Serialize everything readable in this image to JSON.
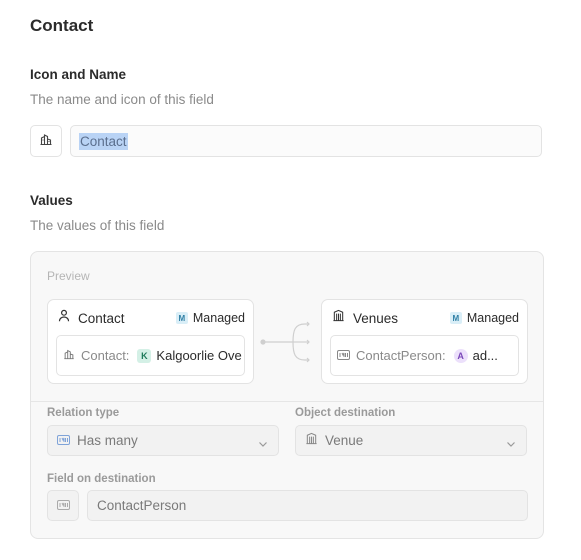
{
  "page": {
    "title": "Contact"
  },
  "icon_and_name": {
    "title": "Icon and Name",
    "description": "The name and icon of this field",
    "icon": "building-icon",
    "name_value": "Contact"
  },
  "values": {
    "title": "Values",
    "description": "The values of this field",
    "preview": {
      "label": "Preview",
      "source_card": {
        "icon": "person-icon",
        "title": "Contact",
        "managed_badge": "M",
        "managed_label": "Managed",
        "field_icon": "building-icon",
        "field_label": "Contact:",
        "value_badge": "K",
        "value_text": "Kalgoorlie Ove"
      },
      "target_card": {
        "icon": "venue-icon",
        "title": "Venues",
        "managed_badge": "M",
        "managed_label": "Managed",
        "field_icon": "relation-many-icon",
        "field_label": "ContactPerson:",
        "value_badge": "A",
        "value_text": "ad..."
      }
    },
    "relation_type": {
      "label": "Relation type",
      "value": "Has many"
    },
    "object_destination": {
      "label": "Object destination",
      "value": "Venue"
    },
    "field_on_destination": {
      "label": "Field on destination",
      "value": "ContactPerson"
    }
  }
}
